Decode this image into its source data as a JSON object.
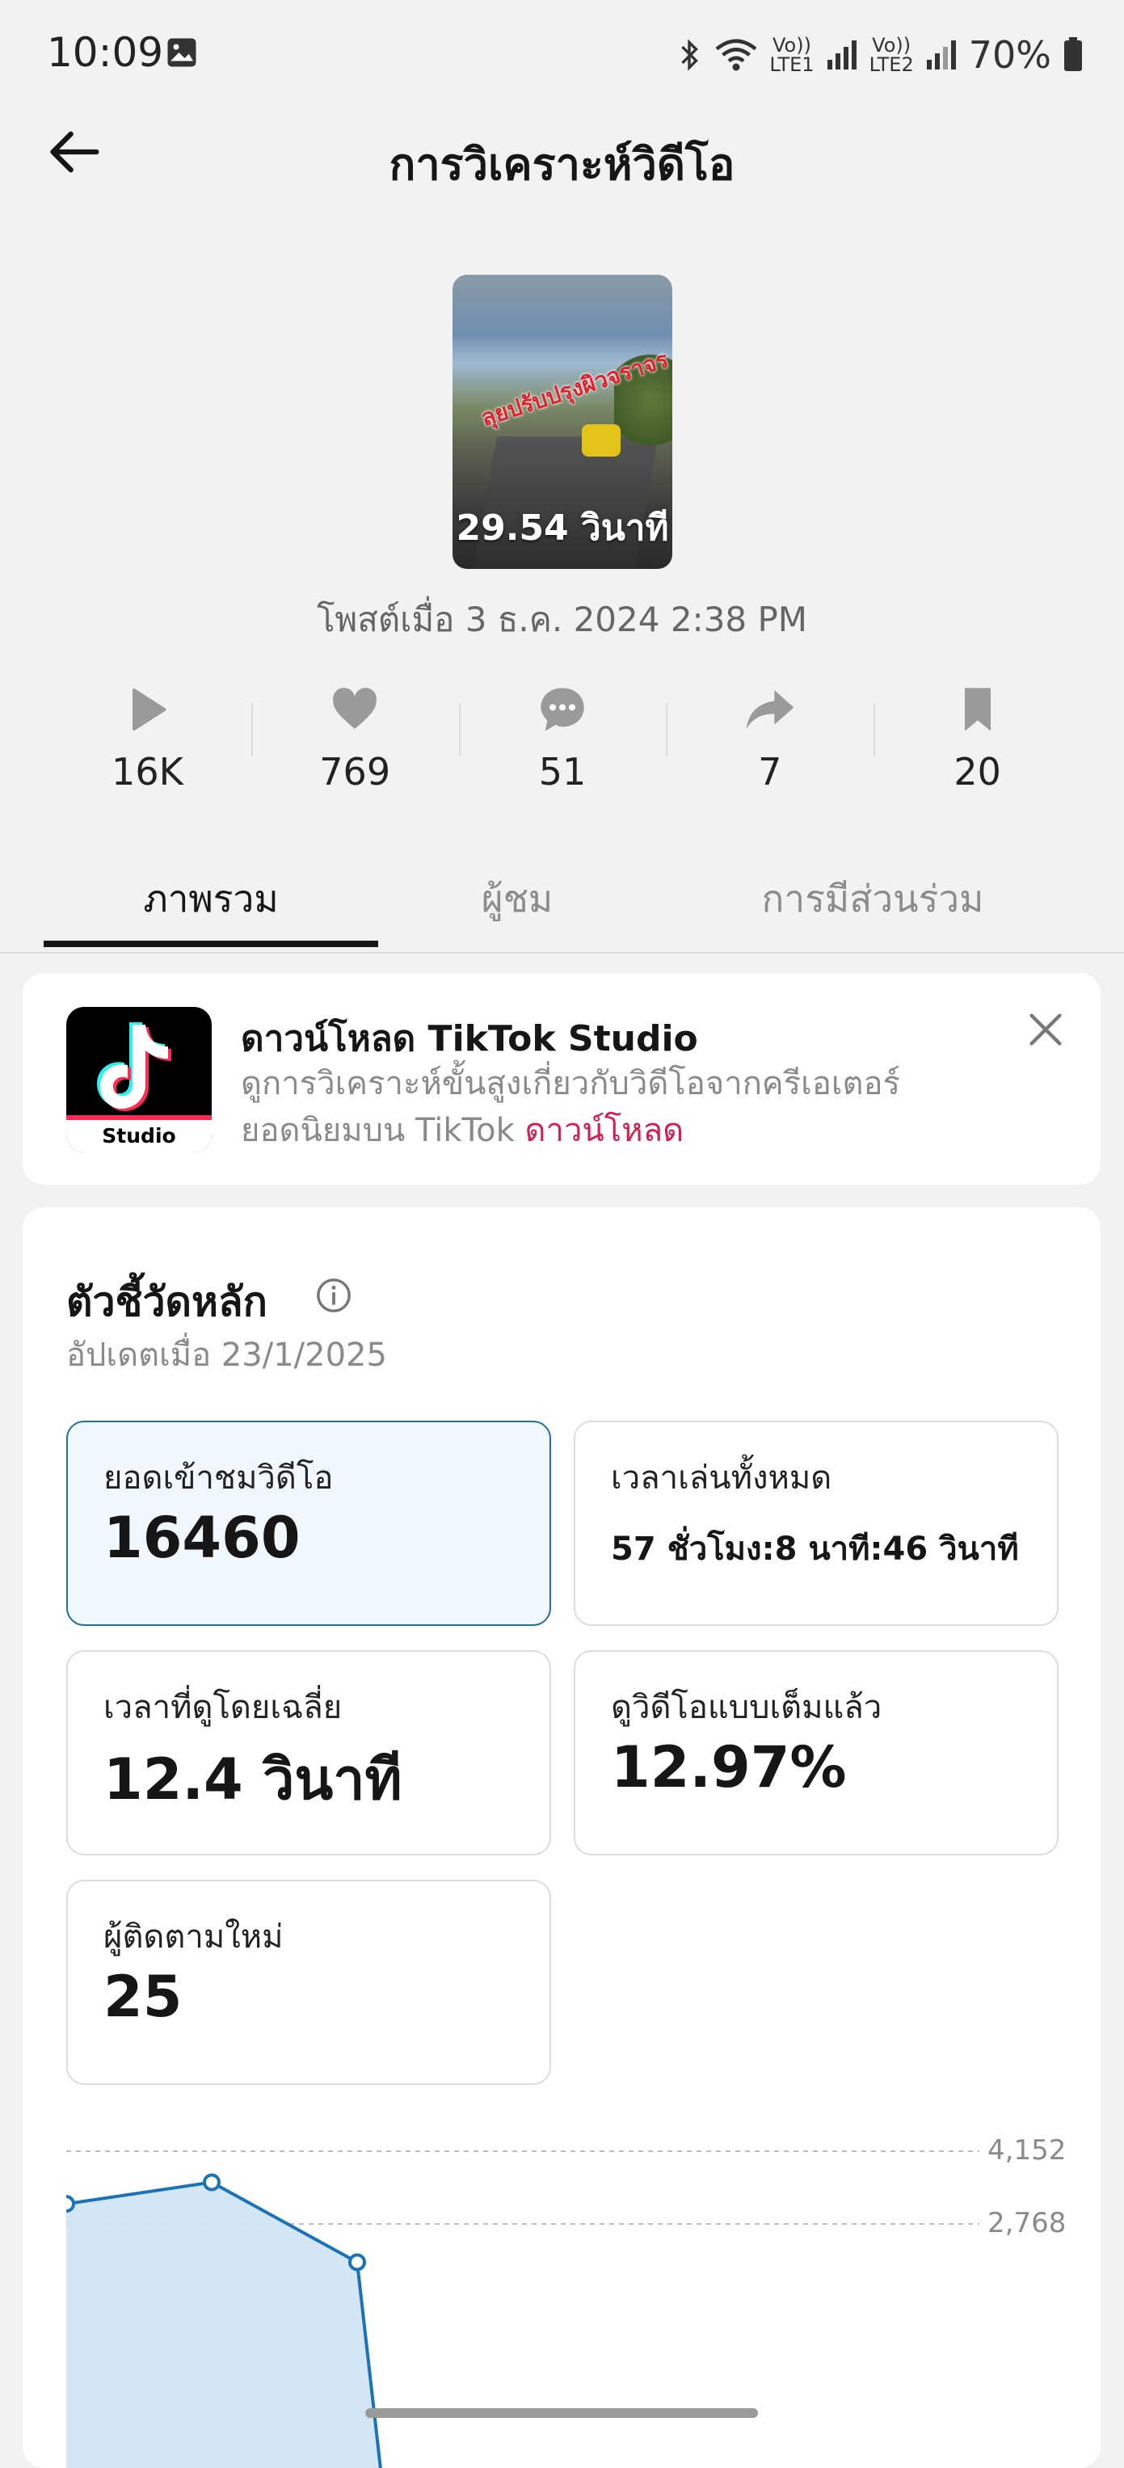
{
  "status_bar": {
    "time": "10:09",
    "sim1": "LTE1",
    "sim2": "LTE2",
    "volte": "Vo))",
    "battery": "70%"
  },
  "header": {
    "title": "การวิเคราะห์วิดีโอ"
  },
  "video": {
    "duration": "29.54 วินาที",
    "overlay_text": "ลุยปรับปรุงผิวจราจร",
    "posted": "โพสต์เมื่อ 3 ธ.ค. 2024 2:38 PM"
  },
  "stats": [
    {
      "icon": "play-icon",
      "value": "16K"
    },
    {
      "icon": "heart-icon",
      "value": "769"
    },
    {
      "icon": "comment-icon",
      "value": "51"
    },
    {
      "icon": "share-icon",
      "value": "7"
    },
    {
      "icon": "bookmark-icon",
      "value": "20"
    }
  ],
  "tabs": [
    {
      "label": "ภาพรวม",
      "active": true
    },
    {
      "label": "ผู้ชม",
      "active": false
    },
    {
      "label": "การมีส่วนร่วม",
      "active": false
    }
  ],
  "download_banner": {
    "icon_label": "Studio",
    "title": "ดาวน์โหลด TikTok Studio",
    "desc1": "ดูการวิเคราะห์ขั้นสูงเกี่ยวกับวิดีโอจากครีเอเตอร์",
    "desc2": "ยอดนิยมบน TikTok",
    "link": "ดาวน์โหลด"
  },
  "metrics": {
    "title": "ตัวชี้วัดหลัก",
    "updated": "อัปเดตเมื่อ 23/1/2025",
    "tiles": [
      {
        "label": "ยอดเข้าชมวิดีโอ",
        "value": "16460",
        "selected": true
      },
      {
        "label": "เวลาเล่นทั้งหมด",
        "value": "57 ชั่วโมง:8 นาที:46 วินาที",
        "selected": false
      },
      {
        "label": "เวลาที่ดูโดยเฉลี่ย",
        "value": "12.4 วินาที",
        "selected": false
      },
      {
        "label": "ดูวิดีโอแบบเต็มแล้ว",
        "value": "12.97%",
        "selected": false
      },
      {
        "label": "ผู้ติดตามใหม่",
        "value": "25",
        "selected": false
      }
    ]
  },
  "chart_data": {
    "type": "area",
    "y_ticks": [
      "4,152",
      "2,768"
    ],
    "y_tick_values": [
      4152,
      2768
    ],
    "values": [
      3150,
      3560,
      2040
    ],
    "color": "#1a73b8"
  },
  "colors": {
    "accent_link": "#d0214f",
    "selected_border": "#1f6e9b",
    "selected_bg": "#f1f8fd"
  }
}
